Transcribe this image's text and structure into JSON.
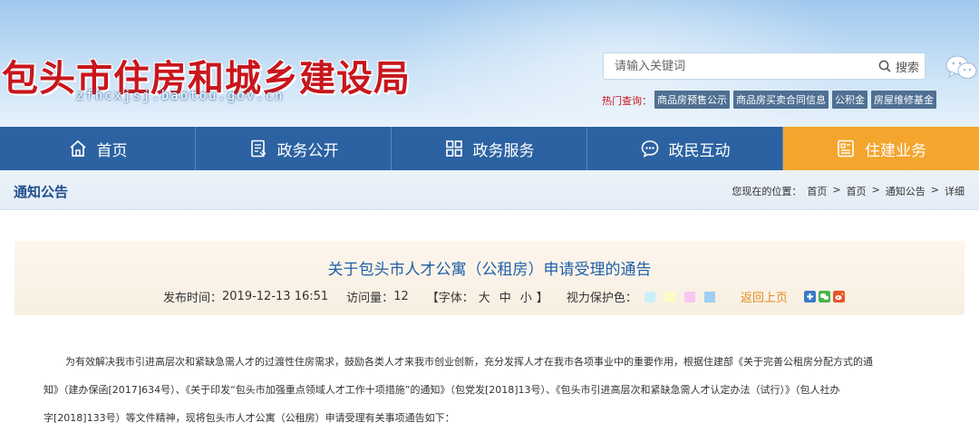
{
  "header": {
    "site_title": "包头市住房和城乡建设局",
    "site_domain": "zfhcxjsj.baotou.gov.cn",
    "search": {
      "placeholder": "请输入关键词",
      "button_label": "搜索"
    },
    "hot_label": "热门查询：",
    "hot_links": [
      "商品房预售公示",
      "商品房买卖合同信息",
      "公积金",
      "房屋维修基金"
    ]
  },
  "nav": {
    "items": [
      {
        "label": "首页",
        "icon": "home-icon"
      },
      {
        "label": "政务公开",
        "icon": "document-icon"
      },
      {
        "label": "政务服务",
        "icon": "grid-icon"
      },
      {
        "label": "政民互动",
        "icon": "chat-icon"
      },
      {
        "label": "住建业务",
        "icon": "list-icon"
      }
    ],
    "active_index": 4
  },
  "section": {
    "title": "通知公告",
    "breadcrumb": [
      "您现在的位置：",
      "首页",
      ">",
      "首页",
      ">",
      "通知公告",
      ">",
      "详细"
    ]
  },
  "article": {
    "title": "关于包头市人才公寓（公租房）申请受理的通告",
    "publish_label": "发布时间：",
    "publish_time": "2019-12-13 16:51",
    "views_label": "访问量：",
    "views": "12",
    "font_label": "【字体：",
    "font_sizes": [
      "大",
      "中",
      "小"
    ],
    "font_label_end": "】",
    "eye_label": "视力保护色：",
    "eye_colors": [
      "#cdeffb",
      "#fdfcc4",
      "#f9c8f1",
      "#9ecff3"
    ],
    "back_label": "返回上页",
    "share_icons": [
      "plus-share-icon",
      "wechat-share-icon",
      "weibo-share-icon"
    ],
    "body_lines": [
      "为有效解决我市引进高层次和紧缺急需人才的过渡性住房需求，鼓励各类人才来我市创业创新，充分发挥人才在我市各项事业中的重要作用，根据住建部《关于完善公租房分配方式的通",
      "知》（建办保函[2017]634号）、《关于印发“包头市加强重点领域人才工作十项措施”的通知》（包党发[2018]13号）、《包头市引进高层次和紧缺急需人才认定办法（试行）》（包人社办",
      "字[2018]133号）等文件精神，现将包头市人才公寓（公租房）申请受理有关事项通告如下："
    ]
  },
  "colors": {
    "nav_bg": "#2c62a2",
    "nav_active": "#f4a52d",
    "title_red": "#c8161d",
    "link_blue": "#1f5fa8",
    "hot_link_bg": "#4f6f93"
  }
}
